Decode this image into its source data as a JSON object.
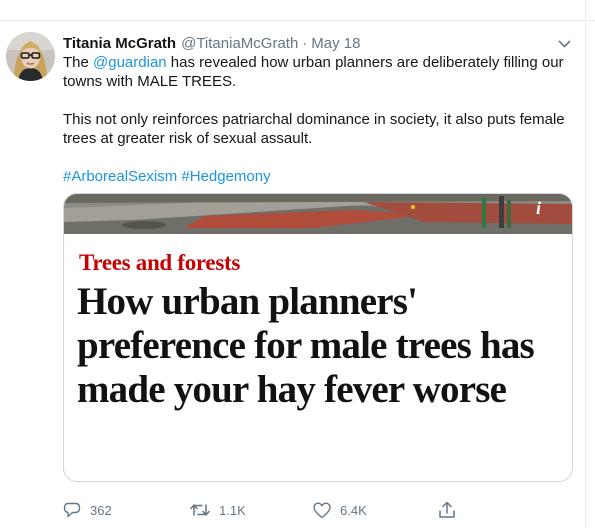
{
  "tweet": {
    "author_name": "Titania McGrath",
    "handle": "@TitaniaMcGrath",
    "separator": "·",
    "date": "May 18",
    "text": {
      "line1_before": "The ",
      "mention": "@guardian",
      "line1_after": " has revealed how urban planners are deliberately filling our towns with MALE TREES.",
      "paragraph2": "This not only reinforces patriarchal dominance in society, it also puts female trees at greater risk of sexual assault.",
      "hashtag1": "#ArborealSexism",
      "hashtag_space": " ",
      "hashtag2": "#Hedgemony"
    },
    "card": {
      "kicker": "Trees and forests",
      "headline": "How urban planners' preference for male trees has made your hay fever worse",
      "info_glyph": "i"
    },
    "actions": {
      "reply_count": "362",
      "retweet_count": "1.1K",
      "like_count": "6.4K"
    }
  },
  "colors": {
    "link": "#1b95e0",
    "muted": "#657786",
    "kicker": "#c70000",
    "border": "#ccd6dd"
  },
  "icons": [
    "caret-down-icon",
    "reply-icon",
    "retweet-icon",
    "like-icon",
    "share-icon",
    "info-icon"
  ]
}
